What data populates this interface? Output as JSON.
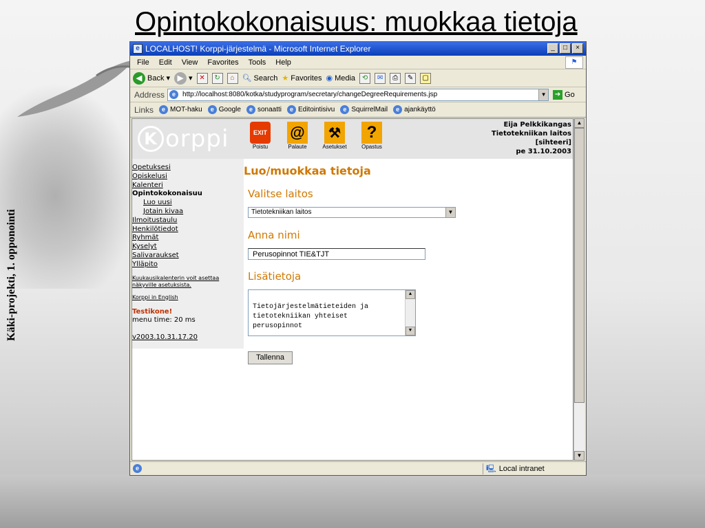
{
  "slide": {
    "title": "Opintokokonaisuus: muokkaa tietoja",
    "side_label": "Käki-projekti, 1. opponointi"
  },
  "browser": {
    "window_title": "LOCALHOST! Korppi-järjestelmä - Microsoft Internet Explorer",
    "menu": [
      "File",
      "Edit",
      "View",
      "Favorites",
      "Tools",
      "Help"
    ],
    "toolbar": {
      "back": "Back",
      "search": "Search",
      "favorites": "Favorites",
      "media": "Media"
    },
    "address_label": "Address",
    "address_url": "http://localhost:8080/kotka/studyprogram/secretary/changeDegreeRequirements.jsp",
    "go_label": "Go",
    "links_label": "Links",
    "links": [
      "MOT-haku",
      "Google",
      "sonaatti",
      "Editointisivu",
      "SquirrelMail",
      "ajankäyttö"
    ],
    "status_zone": "Local intranet"
  },
  "korppi": {
    "logo_text": "orppi",
    "logo_letter": "K",
    "nav_buttons": [
      {
        "label": "Poistu",
        "glyph": "EXIT"
      },
      {
        "label": "Palaute",
        "glyph": "@"
      },
      {
        "label": "Asetukset",
        "glyph": "⚒"
      },
      {
        "label": "Opastus",
        "glyph": "?"
      }
    ],
    "user": {
      "name": "Eija Pelkkikangas",
      "department": "Tietotekniikan laitos",
      "role": "[sihteeri]",
      "date": "pe 31.10.2003"
    }
  },
  "leftnav": {
    "items": [
      "Opetuksesi",
      "Opiskelusi",
      "Kalenteri"
    ],
    "current": "Opintokokonaisuu",
    "sub_items": [
      "Luo uusi",
      "Jotain kivaa"
    ],
    "items2": [
      "Ilmoitustaulu",
      "Henkilötiedot",
      "Ryhmät",
      "Kyselyt",
      "Salivaraukset",
      "Ylläpito"
    ],
    "calendar_note": "Kuukausikalenterin voit asettaa näkyville asetuksista.",
    "english_link": "Korppi in English",
    "test_label": "Testikone!",
    "menu_time": "menu time: 20 ms",
    "version": "v2003.10.31.17.20"
  },
  "form": {
    "heading": "Luo/muokkaa tietoja",
    "dept_label": "Valitse laitos",
    "dept_value": "Tietotekniikan laitos",
    "name_label": "Anna nimi",
    "name_value": "Perusopinnot TIE&TJT",
    "info_label": "Lisätietoja",
    "info_value": "Tietojärjestelmätieteiden ja\ntietotekniikan yhteiset\nperusopinnot",
    "save_label": "Tallenna"
  },
  "colors": {
    "heading_orange": "#d07800",
    "titlebar_blue": "#0a3fb8",
    "warning_red": "#c23000"
  }
}
